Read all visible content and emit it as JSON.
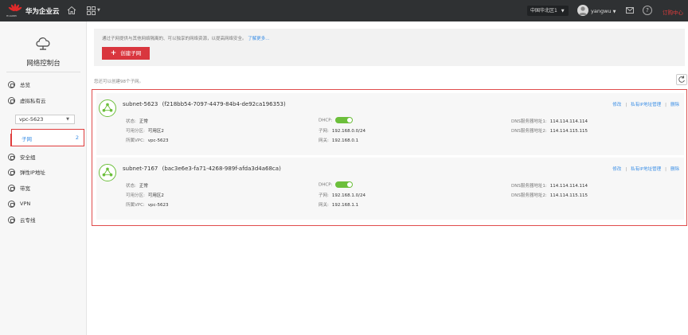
{
  "header": {
    "logo_text": "HUAWEI",
    "brand": "华为企业云",
    "region": "中国华北区1",
    "username": "yangwu",
    "help_glyph": "?",
    "account_center": "订购中心"
  },
  "sidebar": {
    "title": "网络控制台",
    "items": [
      {
        "label": "总览",
        "icon": "overview-icon"
      },
      {
        "label": "虚拟私有云",
        "icon": "vpc-icon"
      },
      {
        "label": "安全组",
        "icon": "security-group-icon"
      },
      {
        "label": "弹性IP地址",
        "icon": "eip-icon"
      },
      {
        "label": "带宽",
        "icon": "bandwidth-icon"
      },
      {
        "label": "VPN",
        "icon": "vpn-icon"
      },
      {
        "label": "云专线",
        "icon": "direct-connect-icon"
      }
    ],
    "vpc_select": "vpc-5623",
    "subnet_nav": {
      "label": "子网",
      "count": "2"
    }
  },
  "main": {
    "info_text": "通过子网提供与其他网络隔离的、可以独享的网络资源，以提高网络安全。",
    "info_link": "了解更多...",
    "create_button": "创建子网",
    "quota_text": "您还可以创建98个子网。",
    "field_labels": {
      "status": "状态:",
      "az": "可用分区:",
      "vpc": "所属VPC:",
      "dhcp": "DHCP:",
      "subnet": "子网:",
      "gateway": "网关:",
      "dns1": "DNS服务器地址1:",
      "dns2": "DNS服务器地址2:"
    },
    "action_labels": {
      "edit": "修改",
      "private_ip": "私有IP地址管理",
      "delete": "删除",
      "sep": "|"
    },
    "subnets": [
      {
        "name": "subnet-5623",
        "id": "(f218bb54-7097-4479-84b4-de92ca196353)",
        "status": "正常",
        "az": "可用区2",
        "vpc": "vpc-5623",
        "dhcp_on": true,
        "cidr": "192.168.0.0/24",
        "gateway": "192.168.0.1",
        "dns1": "114.114.114.114",
        "dns2": "114.114.115.115"
      },
      {
        "name": "subnet-7167",
        "id": "(bac3e6e3-fa71-4268-989f-afda3d4a68ca)",
        "status": "正常",
        "az": "可用区2",
        "vpc": "vpc-5623",
        "dhcp_on": true,
        "cidr": "192.168.1.0/24",
        "gateway": "192.168.1.1",
        "dns1": "114.114.114.114",
        "dns2": "114.114.115.115"
      }
    ]
  },
  "colors": {
    "accent_red": "#d9363e",
    "link_blue": "#3a8ee6",
    "toggle_green": "#6cbf3b",
    "topbar": "#2f3133"
  }
}
